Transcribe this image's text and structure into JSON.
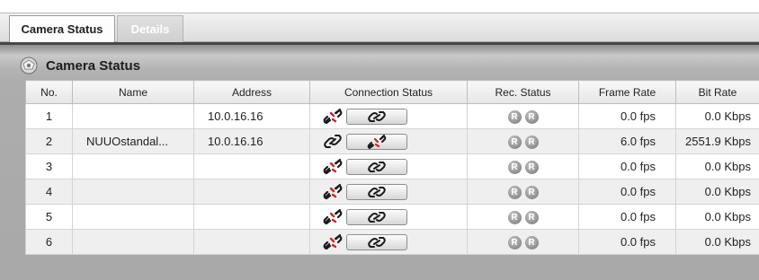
{
  "tabs": [
    {
      "label": "Camera Status",
      "active": true
    },
    {
      "label": "Details",
      "active": false
    }
  ],
  "section": {
    "title": "Camera Status",
    "icon": "camera-status-icon"
  },
  "columns": [
    "No.",
    "Name",
    "Address",
    "Connection Status",
    "Rec. Status",
    "Frame Rate",
    "Bit Rate"
  ],
  "rows": [
    {
      "no": "1",
      "name": "",
      "address": "10.0.16.16",
      "connection": "disconnected",
      "button_action": "connect",
      "rec": [
        "R",
        "R"
      ],
      "frame_rate": "0.0 fps",
      "bit_rate": "0.0 Kbps"
    },
    {
      "no": "2",
      "name": "NUUOstandal...",
      "address": "10.0.16.16",
      "connection": "connected",
      "button_action": "disconnect",
      "rec": [
        "R",
        "R"
      ],
      "frame_rate": "6.0 fps",
      "bit_rate": "2551.9 Kbps"
    },
    {
      "no": "3",
      "name": "",
      "address": "",
      "connection": "disconnected",
      "button_action": "connect",
      "rec": [
        "R",
        "R"
      ],
      "frame_rate": "0.0 fps",
      "bit_rate": "0.0 Kbps"
    },
    {
      "no": "4",
      "name": "",
      "address": "",
      "connection": "disconnected",
      "button_action": "connect",
      "rec": [
        "R",
        "R"
      ],
      "frame_rate": "0.0 fps",
      "bit_rate": "0.0 Kbps"
    },
    {
      "no": "5",
      "name": "",
      "address": "",
      "connection": "disconnected",
      "button_action": "connect",
      "rec": [
        "R",
        "R"
      ],
      "frame_rate": "0.0 fps",
      "bit_rate": "0.0 Kbps"
    },
    {
      "no": "6",
      "name": "",
      "address": "",
      "connection": "disconnected",
      "button_action": "connect",
      "rec": [
        "R",
        "R"
      ],
      "frame_rate": "0.0 fps",
      "bit_rate": "0.0 Kbps"
    }
  ],
  "icons": {
    "connected": "link-icon",
    "disconnected": "broken-link-icon"
  },
  "colors": {
    "tab_inactive_text": "#ffffff",
    "panel_bg": "#a8a8a8",
    "rec_badge": "#9a9a9a"
  }
}
